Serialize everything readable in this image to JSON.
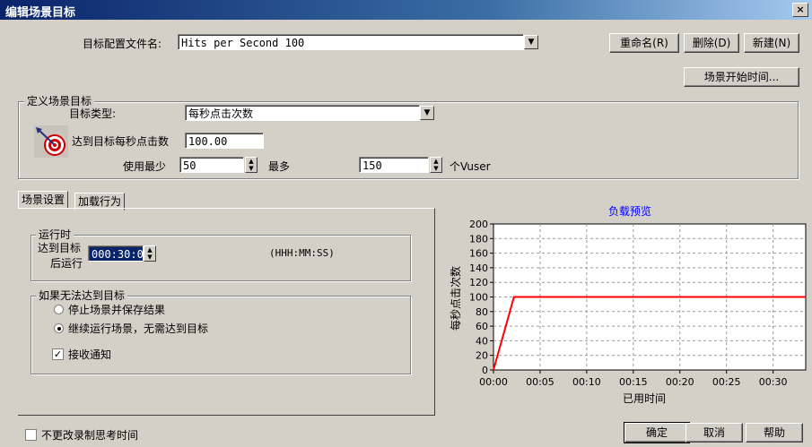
{
  "window": {
    "title": "编辑场景目标",
    "close_glyph": "×"
  },
  "profile": {
    "label": "目标配置文件名:",
    "value": "Hits per Second 100",
    "rename_button": "重命名(R)",
    "delete_button": "删除(D)",
    "new_button": "新建(N)",
    "start_time_button": "场景开始时间..."
  },
  "goal": {
    "group_title": "定义场景目标",
    "type_label": "目标类型:",
    "type_value": "每秒点击次数",
    "target_label": "达到目标每秒点击数",
    "target_value": "100.00",
    "use_min_label": "使用最少",
    "min_value": "50",
    "max_label": "最多",
    "max_value": "150",
    "vuser_label": "个Vuser"
  },
  "tabs": [
    {
      "label": "场景设置"
    },
    {
      "label": "加载行为"
    }
  ],
  "run_time": {
    "group_title": "运行时",
    "label_line1": "达到目标",
    "label_line2": "后运行",
    "value": "000:30:0",
    "format_hint": "(HHH:MM:SS)"
  },
  "cannot_reach": {
    "group_title": "如果无法达到目标",
    "option_stop": "停止场景并保存结果",
    "option_continue": "继续运行场景，无需达到目标",
    "selected": "continue",
    "notify_label": "接收通知",
    "notify_checked": true
  },
  "chart_data": {
    "type": "line",
    "title": "负载预览",
    "xlabel": "已用时间",
    "ylabel": "每秒点击次数",
    "x_ticks": [
      "00:00",
      "00:05",
      "00:10",
      "00:15",
      "00:20",
      "00:25",
      "00:30"
    ],
    "y_ticks": [
      0,
      20,
      40,
      60,
      80,
      100,
      120,
      140,
      160,
      180,
      200
    ],
    "xlim": [
      0,
      33.5
    ],
    "ylim": [
      0,
      200
    ],
    "grid": true,
    "series": [
      {
        "color": "#ff0000",
        "points": [
          [
            0,
            0
          ],
          [
            2.2,
            100
          ],
          [
            33.5,
            100
          ]
        ]
      }
    ],
    "title_color": "#0000ff"
  },
  "footer": {
    "no_change_think_label": "不更改录制思考时间",
    "no_change_think_checked": false,
    "ok_button": "确定",
    "cancel_button": "取消",
    "help_button": "帮助"
  }
}
